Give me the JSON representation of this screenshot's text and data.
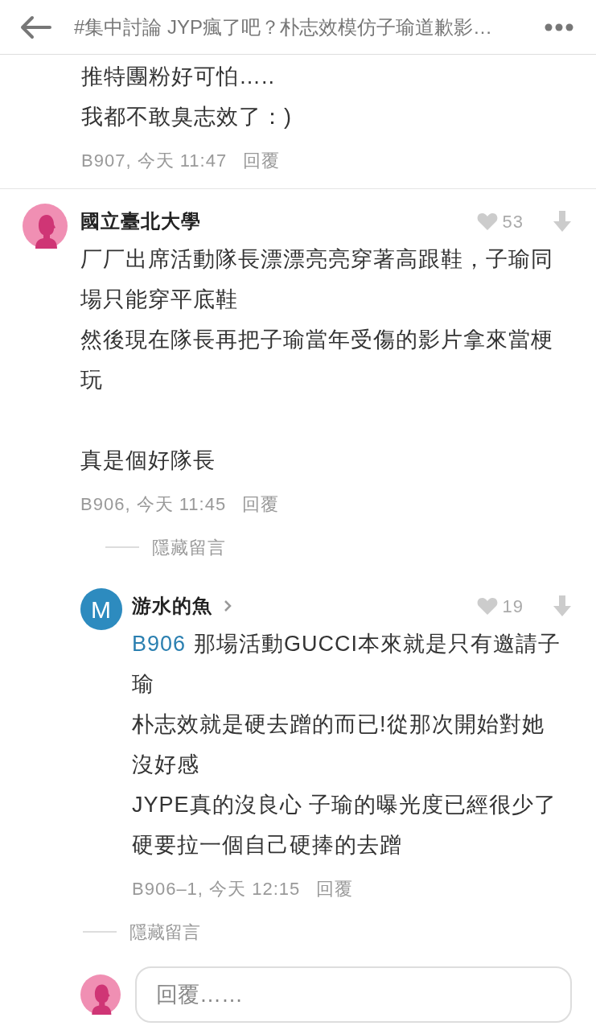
{
  "header": {
    "title": "#集中討論 JYP瘋了吧？朴志效模仿子瑜道歉影…"
  },
  "comments": [
    {
      "kind": "partial",
      "lines": [
        {
          "text": "推特團粉好可怕….."
        },
        {
          "text": "我都不敢臭志效了：)"
        }
      ],
      "meta": "B907, 今天 11:47",
      "reply_label": "回覆"
    },
    {
      "kind": "full",
      "author": "國立臺北大學",
      "likes": "53",
      "lines": [
        {
          "text": "厂厂出席活動隊長漂漂亮亮穿著高跟鞋，子瑜同"
        },
        {
          "text": "場只能穿平底鞋"
        },
        {
          "text": "然後現在隊長再把子瑜當年受傷的影片拿來當梗"
        },
        {
          "text": "玩"
        },
        {
          "text": "真是個好隊長",
          "gap_before": true
        }
      ],
      "meta": "B906, 今天 11:45",
      "reply_label": "回覆",
      "hide_label": "隱藏留言",
      "replies": [
        {
          "avatar_letter": "M",
          "author": "游水的魚",
          "profile_link": true,
          "likes": "19",
          "mention": "B906",
          "lines": [
            {
              "text": "那場活動GUCCI本來就是只有邀請子"
            },
            {
              "text": "瑜"
            },
            {
              "text": "朴志效就是硬去蹭的而已!從那次開始對她"
            },
            {
              "text": "沒好感"
            },
            {
              "text": "JYPE真的沒良心 子瑜的曝光度已經很少了"
            },
            {
              "text": "硬要拉一個自己硬捧的去蹭"
            }
          ],
          "meta": "B906–1, 今天 12:15",
          "reply_label": "回覆",
          "hide_label": "隱藏留言"
        }
      ]
    }
  ],
  "composer": {
    "placeholder": "回覆……"
  }
}
